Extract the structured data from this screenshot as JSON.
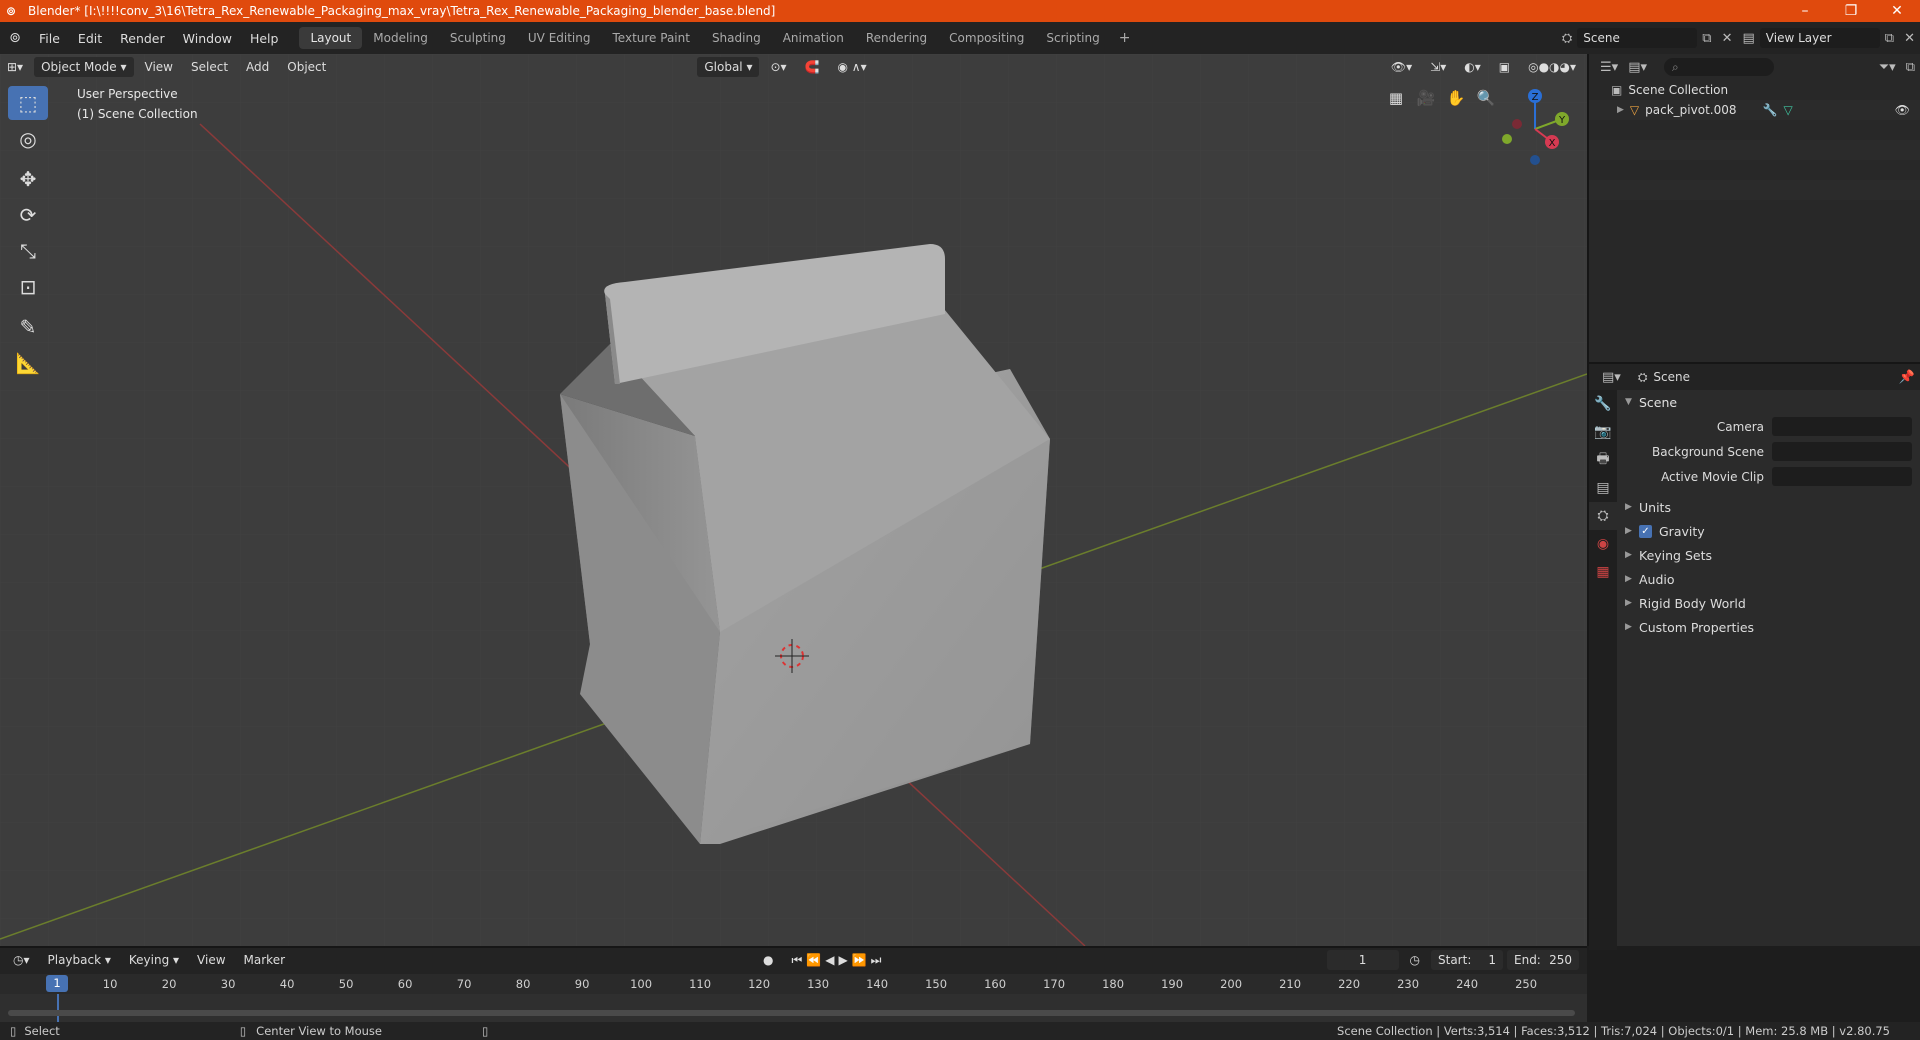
{
  "window": {
    "title": "Blender* [I:\\!!!!conv_3\\16\\Tetra_Rex_Renewable_Packaging_max_vray\\Tetra_Rex_Renewable_Packaging_blender_base.blend]",
    "minimize": "–",
    "maximize": "❐",
    "close": "✕"
  },
  "menu": {
    "items": [
      "File",
      "Edit",
      "Render",
      "Window",
      "Help"
    ],
    "tabs": [
      "Layout",
      "Modeling",
      "Sculpting",
      "UV Editing",
      "Texture Paint",
      "Shading",
      "Animation",
      "Rendering",
      "Compositing",
      "Scripting"
    ],
    "active_tab": "Layout",
    "plus": "+",
    "scene_name": "Scene",
    "view_layer": "View Layer"
  },
  "viewport": {
    "mode": "Object Mode",
    "menus": [
      "View",
      "Select",
      "Add",
      "Object"
    ],
    "orientation": "Global",
    "perspective": "User Perspective",
    "collection": "(1) Scene Collection",
    "gizmo": {
      "z": "Z",
      "y": "Y",
      "x": "X"
    }
  },
  "outliner": {
    "search_placeholder": "⌕",
    "root": "Scene Collection",
    "items": [
      {
        "name": "pack_pivot.008"
      }
    ]
  },
  "properties": {
    "context": "Scene",
    "panel": "Scene",
    "fields": [
      {
        "label": "Camera",
        "value": ""
      },
      {
        "label": "Background Scene",
        "value": ""
      },
      {
        "label": "Active Movie Clip",
        "value": ""
      }
    ],
    "subpanels": [
      {
        "label": "Units",
        "checkbox": false
      },
      {
        "label": "Gravity",
        "checkbox": true
      },
      {
        "label": "Keying Sets",
        "checkbox": false
      },
      {
        "label": "Audio",
        "checkbox": false
      },
      {
        "label": "Rigid Body World",
        "checkbox": false
      },
      {
        "label": "Custom Properties",
        "checkbox": false
      }
    ]
  },
  "timeline": {
    "menus": [
      "Playback",
      "Keying",
      "View",
      "Marker"
    ],
    "current_frame": "1",
    "start_label": "Start:",
    "start": "1",
    "end_label": "End:",
    "end": "250",
    "ticks": [
      "1",
      "10",
      "20",
      "30",
      "40",
      "50",
      "60",
      "70",
      "80",
      "90",
      "100",
      "110",
      "120",
      "130",
      "140",
      "150",
      "160",
      "170",
      "180",
      "190",
      "200",
      "210",
      "220",
      "230",
      "240",
      "250"
    ]
  },
  "status": {
    "select": "Select",
    "center": "Center View to Mouse",
    "info": "Scene Collection | Verts:3,514 | Faces:3,512 | Tris:7,024 | Objects:0/1 | Mem: 25.8 MB | v2.80.75"
  },
  "colors": {
    "title_bar": "#e04a0d",
    "accent": "#4772b3",
    "viewport_bg": "#3d3d3d"
  }
}
